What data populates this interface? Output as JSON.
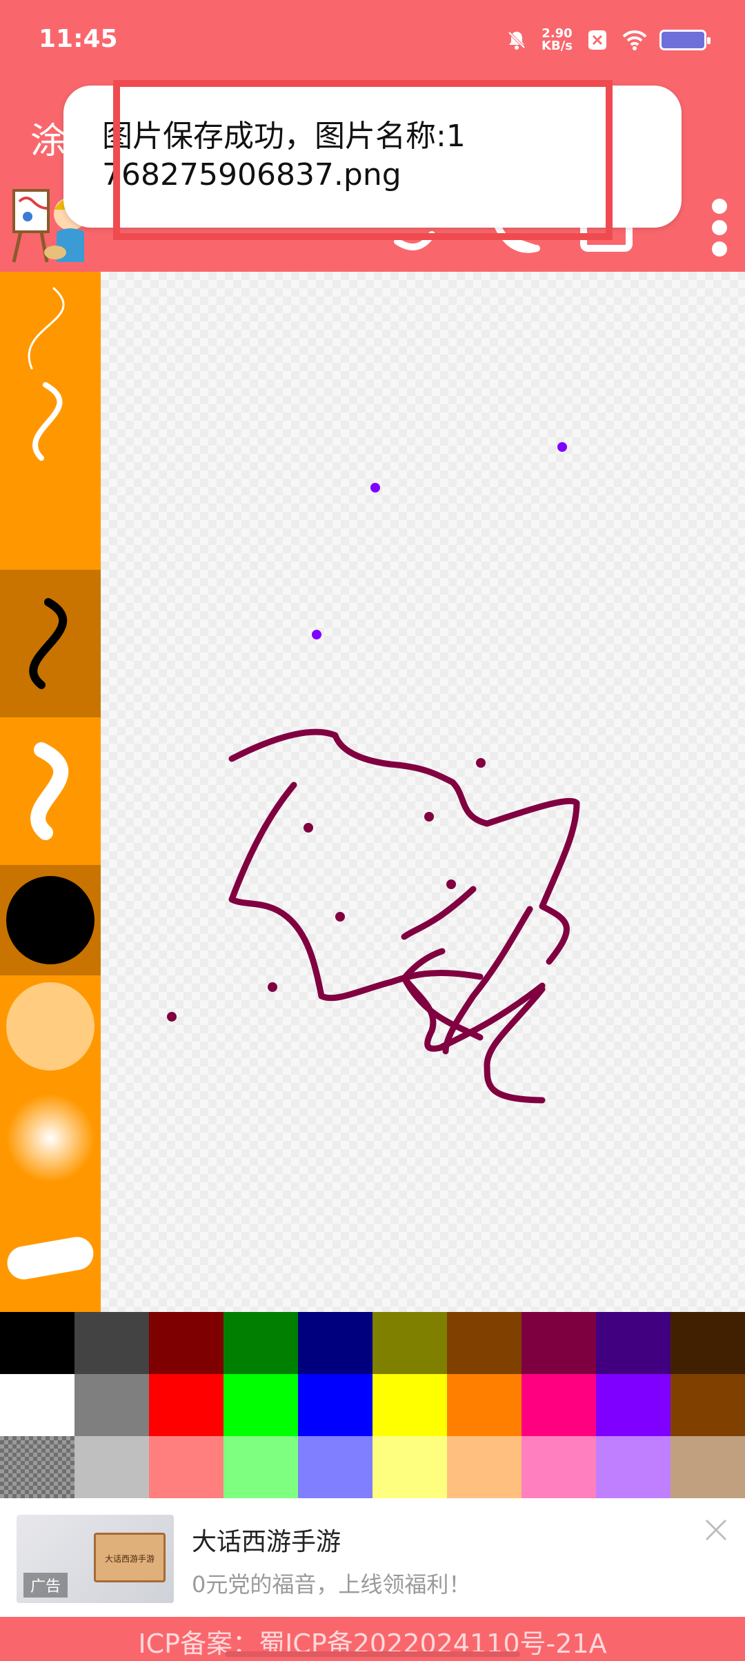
{
  "status": {
    "time": "11:45",
    "net_speed_value": "2.90",
    "net_speed_unit": "KB/s"
  },
  "app": {
    "title": "涂"
  },
  "toast": {
    "message": "图片保存成功，图片名称:1768275906837.png"
  },
  "brushes": [
    {
      "name": "thin-line-brush",
      "selected": false
    },
    {
      "name": "medium-line-brush",
      "selected": false
    },
    {
      "name": "thick-line-brush",
      "selected": true
    },
    {
      "name": "extra-thick-line-brush",
      "selected": false
    },
    {
      "name": "solid-circle-brush",
      "selected": false
    },
    {
      "name": "soft-circle-brush",
      "selected": false
    },
    {
      "name": "glow-brush",
      "selected": false
    },
    {
      "name": "marker-brush",
      "selected": false
    }
  ],
  "palette": {
    "selected_color": "#8800ff",
    "rows": [
      [
        "#000000",
        "#434343",
        "#7f0000",
        "#007f00",
        "#00007f",
        "#7f7f00",
        "#7f4000",
        "#7f0040",
        "#40007f",
        "#402000"
      ],
      [
        "#ffffff",
        "#7f7f7f",
        "#ff0000",
        "#00ff00",
        "#0000ff",
        "#ffff00",
        "#ff8000",
        "#ff0080",
        "#8000ff",
        "#804000"
      ],
      [
        "transparent",
        "#bfbfbf",
        "#ff7f7f",
        "#7fff7f",
        "#7f7fff",
        "#ffff7f",
        "#ffc07f",
        "#ff7fbf",
        "#c07fff",
        "#c0a07f"
      ]
    ]
  },
  "drawing": {
    "stroke_color": "#800040",
    "dot_color": "#8000ff"
  },
  "ad": {
    "title": "大话西游手游",
    "description": "0元党的福音，上线领福利！",
    "badge": "广告",
    "box_label": "大话西游手游"
  },
  "footer": {
    "icp_text": "ICP备案：蜀ICP备2022024110号-21A"
  }
}
